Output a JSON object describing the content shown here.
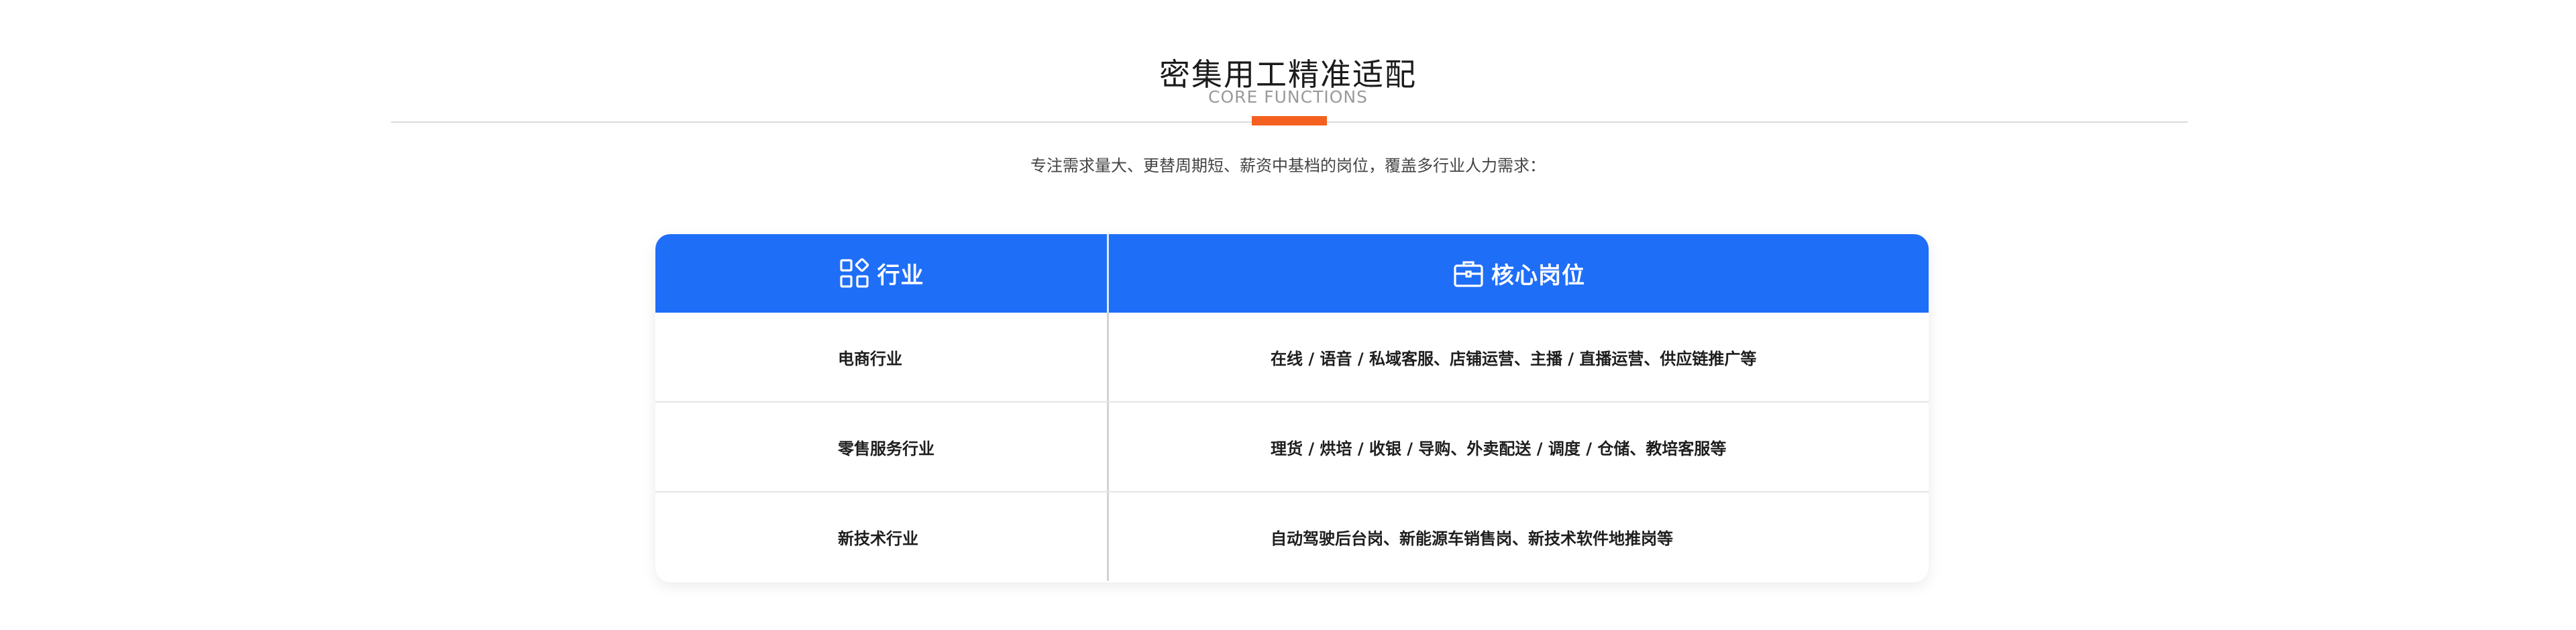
{
  "section": {
    "title": "密集用工精准适配",
    "subtitle": "CORE FUNCTIONS",
    "intro": "专注需求量大、更替周期短、薪资中基档的岗位，覆盖多行业人力需求："
  },
  "colors": {
    "accent": "#f4601f",
    "header_bg": "#1f6ef7"
  },
  "table": {
    "headers": [
      {
        "label": "行业",
        "icon": "grid-apps-icon"
      },
      {
        "label": "核心岗位",
        "icon": "briefcase-icon"
      }
    ],
    "rows": [
      {
        "industry": "电商行业",
        "positions": "在线 / 语音 / 私域客服、店铺运营、主播 / 直播运营、供应链推广等"
      },
      {
        "industry": "零售服务行业",
        "positions": "理货 / 烘培 / 收银 / 导购、外卖配送 / 调度 / 仓储、教培客服等"
      },
      {
        "industry": "新技术行业",
        "positions": "自动驾驶后台岗、新能源车销售岗、新技术软件地推岗等"
      }
    ]
  }
}
